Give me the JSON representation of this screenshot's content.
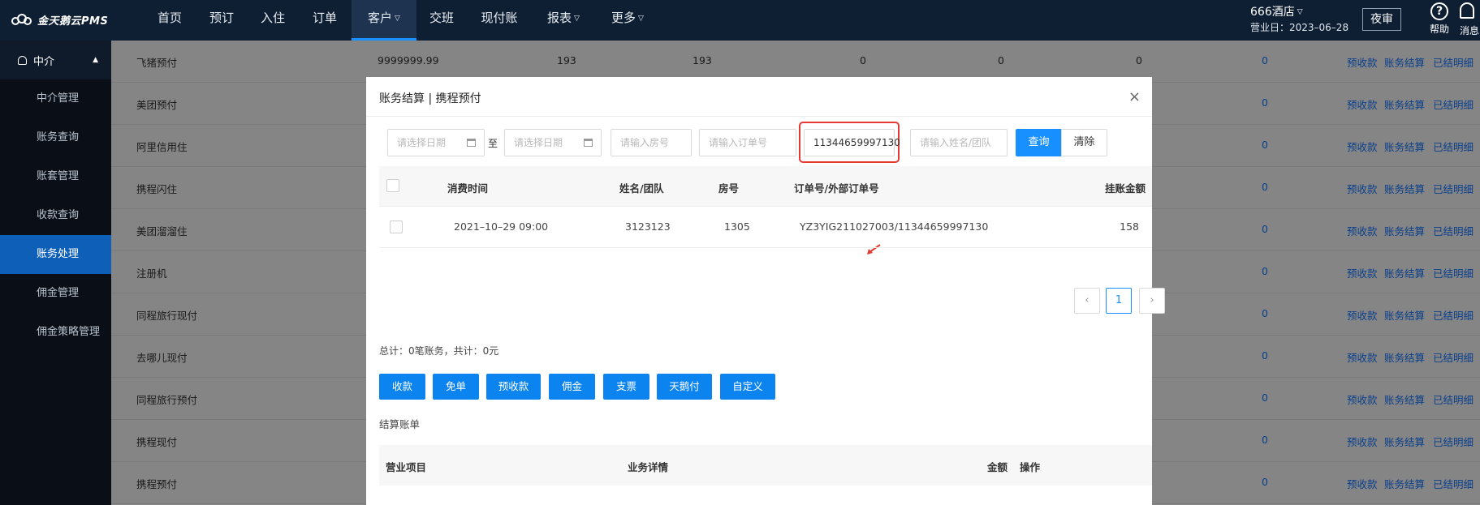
{
  "app": {
    "logo_text": "金天鹅云PMS",
    "nav": [
      {
        "label": "首页"
      },
      {
        "label": "预订"
      },
      {
        "label": "入住"
      },
      {
        "label": "订单"
      },
      {
        "label": "客户"
      },
      {
        "label": "交班"
      },
      {
        "label": "现付账"
      },
      {
        "label": "报表"
      },
      {
        "label": "更多"
      }
    ],
    "hotel_name": "666酒店",
    "business_date": "营业日：2023–06–28",
    "night_audit_label": "夜审",
    "help_label": "帮助",
    "message_label": "消息"
  },
  "sidebar": {
    "section_label": "中介",
    "items": [
      {
        "label": "中介管理"
      },
      {
        "label": "账务查询"
      },
      {
        "label": "账套管理"
      },
      {
        "label": "收款查询"
      },
      {
        "label": "账务处理"
      },
      {
        "label": "佣金管理"
      },
      {
        "label": "佣金策略管理"
      }
    ]
  },
  "background_table": {
    "rows": [
      {
        "name": "飞猪预付",
        "c1": "9999999.99",
        "c2": "193",
        "c3": "193",
        "c4": "0",
        "c5": "0",
        "c6": "0",
        "c7": "0"
      },
      {
        "name": "美团预付",
        "c7": "0"
      },
      {
        "name": "阿里信用住",
        "c7": "0"
      },
      {
        "name": "携程闪住",
        "c7": "0"
      },
      {
        "name": "美团溜溜住",
        "c7": "0"
      },
      {
        "name": "注册机",
        "c7": "0"
      },
      {
        "name": "同程旅行现付",
        "c7": "0"
      },
      {
        "name": "去哪儿现付",
        "c7": "0"
      },
      {
        "name": "同程旅行预付",
        "c7": "0"
      },
      {
        "name": "携程现付",
        "c7": "0"
      },
      {
        "name": "携程预付",
        "c7": "0"
      }
    ],
    "link_prepay": "预收款",
    "link_settle": "账务结算",
    "link_settled": "已结明细"
  },
  "modal": {
    "title": "账务结算 | 携程预付",
    "close_icon": "×",
    "filters": {
      "start_date_placeholder": "请选择日期",
      "to_label": "至",
      "end_date_placeholder": "请选择日期",
      "room_placeholder": "请输入房号",
      "order_placeholder": "请输入订单号",
      "external_order_value": "11344659997130",
      "name_placeholder": "请输入姓名/团队",
      "search_label": "查询",
      "clear_label": "清除"
    },
    "table": {
      "headers": {
        "time": "消费时间",
        "name": "姓名/团队",
        "room": "房号",
        "order": "订单号/外部订单号",
        "amount": "挂账金额"
      },
      "rows": [
        {
          "time": "2021–10–29 09:00",
          "name": "3123123",
          "room": "1305",
          "order": "YZ3YIG211027003/11344659997130",
          "amount": "158"
        }
      ]
    },
    "pagination": {
      "prev": "‹",
      "current": "1",
      "next": "›"
    },
    "totals": "总计：0笔账务，共计：0元",
    "actions": [
      {
        "label": "收款"
      },
      {
        "label": "免单"
      },
      {
        "label": "预收款"
      },
      {
        "label": "佣金"
      },
      {
        "label": "支票"
      },
      {
        "label": "天鹅付"
      },
      {
        "label": "自定义"
      }
    ],
    "settle_section_title": "结算账单",
    "settle_table_headers": {
      "item": "营业项目",
      "detail": "业务详情",
      "amount": "金额",
      "operation": "操作"
    }
  }
}
